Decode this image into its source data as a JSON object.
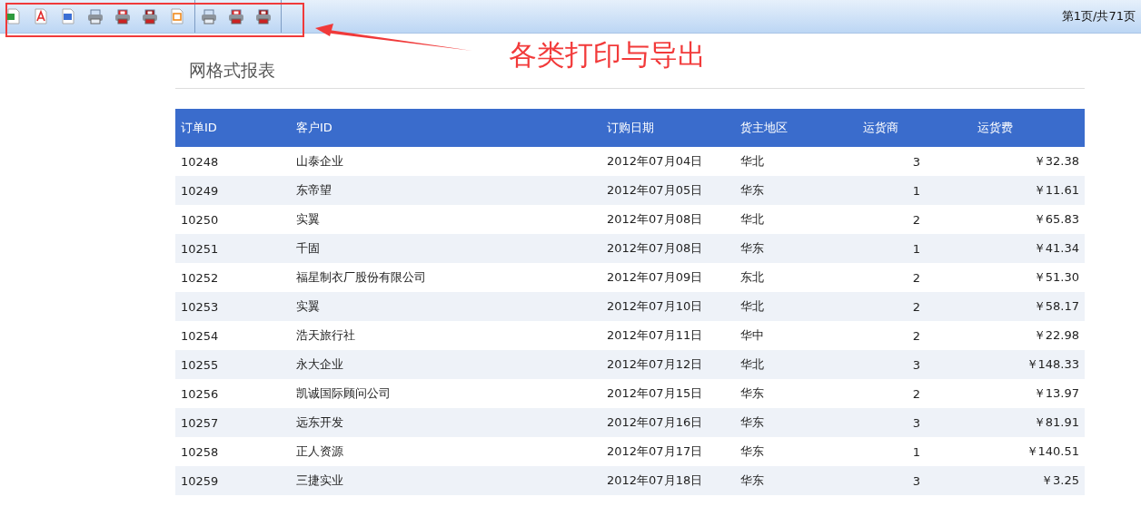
{
  "toolbar": {
    "groups": [
      [
        {
          "kind": "excel"
        },
        {
          "kind": "pdf"
        },
        {
          "kind": "word"
        },
        {
          "kind": "print"
        },
        {
          "kind": "print-f"
        },
        {
          "kind": "print-p"
        },
        {
          "kind": "html"
        }
      ],
      [
        {
          "kind": "print"
        },
        {
          "kind": "print-f"
        },
        {
          "kind": "print-p"
        }
      ]
    ],
    "page_indicator": "第1页/共71页"
  },
  "annotation": {
    "text": "各类打印与导出"
  },
  "report": {
    "title": "网格式报表",
    "columns": [
      "订单ID",
      "客户ID",
      "订购日期",
      "货主地区",
      "运货商",
      "运货费"
    ],
    "rows": [
      [
        "10248",
        "山泰企业",
        "2012年07月04日",
        "华北",
        "3",
        "￥32.38"
      ],
      [
        "10249",
        "东帝望",
        "2012年07月05日",
        "华东",
        "1",
        "￥11.61"
      ],
      [
        "10250",
        "实翼",
        "2012年07月08日",
        "华北",
        "2",
        "￥65.83"
      ],
      [
        "10251",
        "千固",
        "2012年07月08日",
        "华东",
        "1",
        "￥41.34"
      ],
      [
        "10252",
        "福星制衣厂股份有限公司",
        "2012年07月09日",
        "东北",
        "2",
        "￥51.30"
      ],
      [
        "10253",
        "实翼",
        "2012年07月10日",
        "华北",
        "2",
        "￥58.17"
      ],
      [
        "10254",
        "浩天旅行社",
        "2012年07月11日",
        "华中",
        "2",
        "￥22.98"
      ],
      [
        "10255",
        "永大企业",
        "2012年07月12日",
        "华北",
        "3",
        "￥148.33"
      ],
      [
        "10256",
        "凯诚国际顾问公司",
        "2012年07月15日",
        "华东",
        "2",
        "￥13.97"
      ],
      [
        "10257",
        "远东开发",
        "2012年07月16日",
        "华东",
        "3",
        "￥81.91"
      ],
      [
        "10258",
        "正人资源",
        "2012年07月17日",
        "华东",
        "1",
        "￥140.51"
      ],
      [
        "10259",
        "三捷实业",
        "2012年07月18日",
        "华东",
        "3",
        "￥3.25"
      ]
    ]
  }
}
